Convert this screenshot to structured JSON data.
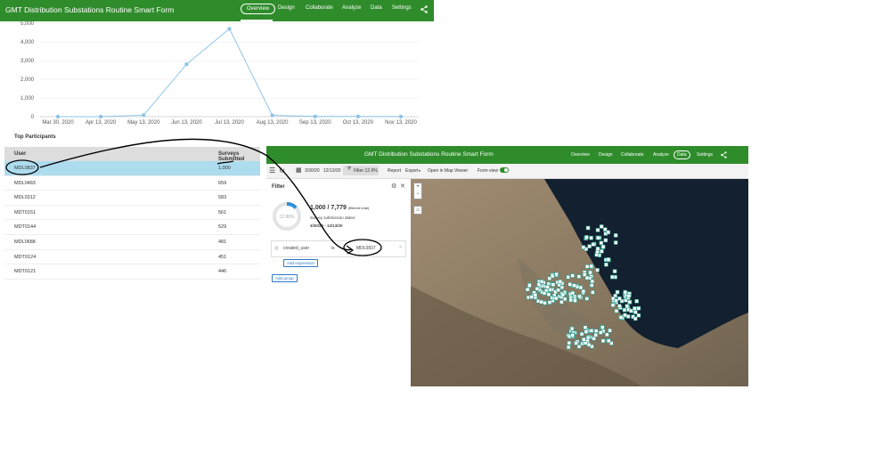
{
  "app1": {
    "title": "GMT Distribution Substations Routine Smart Form",
    "nav": [
      "Overview",
      "Design",
      "Collaborate",
      "Analyze",
      "Data",
      "Settings"
    ],
    "active_nav": "Overview"
  },
  "chart_data": {
    "type": "line",
    "x": [
      "Mar 30, 2020",
      "Apr 13, 2020",
      "May 13, 2020",
      "Jun 13, 2020",
      "Jul 13, 2020",
      "Aug 13, 2020",
      "Sep 13, 2020",
      "Oct 13, 2020",
      "Nov 13, 2020"
    ],
    "values": [
      0,
      0,
      80,
      2800,
      4700,
      70,
      10,
      10,
      5
    ],
    "y_ticks": [
      "5,000",
      "4,000",
      "3,000",
      "2,000",
      "1,000",
      "0"
    ],
    "ylim": [
      0,
      5000
    ],
    "color": "#8ec5e8",
    "title": "",
    "xlabel": "",
    "ylabel": ""
  },
  "participants": {
    "title": "Top Participants",
    "headers": {
      "user": "User",
      "surveys": "Surveys Submitted"
    },
    "rows": [
      {
        "user": "MDL0837",
        "count": "1,000"
      },
      {
        "user": "MDL0483",
        "count": "659"
      },
      {
        "user": "MDL0312",
        "count": "583"
      },
      {
        "user": "MDT0151",
        "count": "561"
      },
      {
        "user": "MDT0144",
        "count": "529"
      },
      {
        "user": "MDL0688",
        "count": "481"
      },
      {
        "user": "MDT0124",
        "count": "451"
      },
      {
        "user": "MDT0121",
        "count": "446"
      }
    ]
  },
  "app2": {
    "title": "GMT Distribution Substations Routine Smart Form",
    "nav": [
      "Overview",
      "Design",
      "Collaborate",
      "Analyze",
      "Data",
      "Settings"
    ],
    "active_nav": "Data",
    "toolbar": {
      "date_from": "3/30/20",
      "date_to": "12/13/20",
      "filter": "Filter 12.9%",
      "report": "Report",
      "export": "Export",
      "open_map_viewer": "Open in Map Viewer",
      "form_view": "Form view"
    },
    "filter": {
      "title": "Filter",
      "percent": "12.86%",
      "count": "1,000",
      "total": "7,779",
      "filtered_total": "(filtered total)",
      "submission_label": "Survey submission dates:",
      "date_range": "3/30/20 - 12/13/20",
      "field": "created_user",
      "operator": "is",
      "value": "MDL0837",
      "add_expression": "Add expression",
      "add_group": "Add group"
    }
  }
}
